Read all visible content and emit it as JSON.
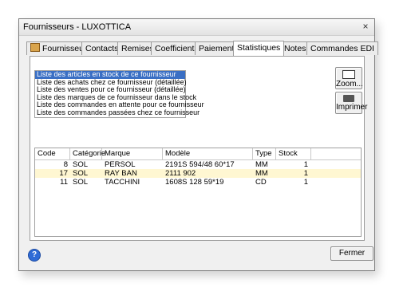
{
  "window": {
    "title": "Fournisseurs - LUXOTTICA",
    "close_glyph": "×"
  },
  "tabs": [
    {
      "label": "Fournisseur",
      "icon": "folder-icon"
    },
    {
      "label": "Contacts"
    },
    {
      "label": "Remises"
    },
    {
      "label": "Coefficients"
    },
    {
      "label": "Paiements"
    },
    {
      "label": "Statistiques",
      "active": true
    },
    {
      "label": "Notes"
    },
    {
      "label": "Commandes EDI"
    }
  ],
  "reports": [
    "Liste des articles en stock de ce fournisseur",
    "Liste des achats chez ce fournisseur (détaillée)",
    "Liste des ventes pour ce fournisseur (détaillée)",
    "Liste des marques de ce fournisseur dans le stock",
    "Liste des commandes en attente pour ce fournisseur",
    "Liste des commandes passées chez ce fournisseur"
  ],
  "reports_selected_index": 0,
  "buttons": {
    "zoom": "Zoom...",
    "print": "Imprimer",
    "close": "Fermer",
    "help": "?"
  },
  "table": {
    "columns": [
      "Code",
      "Catégorie",
      "Marque",
      "Modèle",
      "Type",
      "Stock"
    ],
    "rows": [
      {
        "code": "8",
        "categorie": "SOL",
        "marque": "PERSOL",
        "modele": "2191S 594/48 60*17",
        "type": "MM",
        "stock": "1"
      },
      {
        "code": "17",
        "categorie": "SOL",
        "marque": "RAY BAN",
        "modele": "2111 902",
        "type": "MM",
        "stock": "1"
      },
      {
        "code": "11",
        "categorie": "SOL",
        "marque": "TACCHINI",
        "modele": "1608S 128 59*19",
        "type": "CD",
        "stock": "1"
      }
    ],
    "highlighted_row": 1
  },
  "colors": {
    "selection": "#3a6fc4",
    "row_highlight": "#fff7d2",
    "help": "#2f6bd6"
  }
}
